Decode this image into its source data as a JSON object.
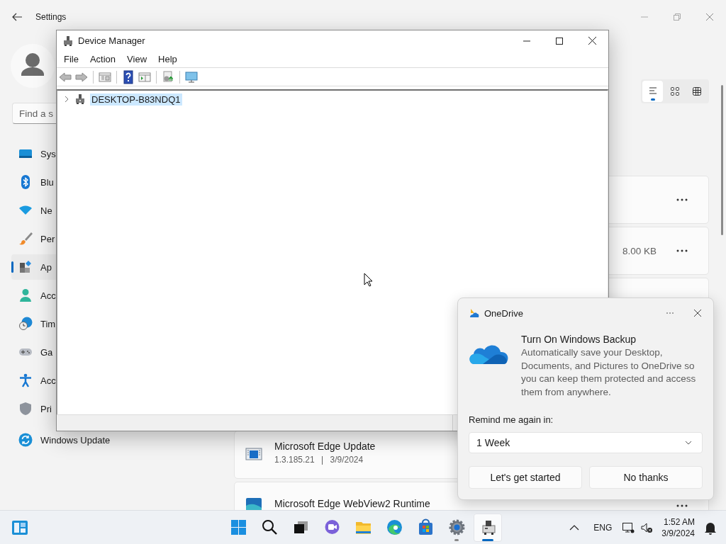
{
  "settings": {
    "title": "Settings",
    "search": {
      "placeholder": "Find a s"
    },
    "nav": [
      {
        "label": "Sys",
        "selected": false
      },
      {
        "label": "Blu",
        "selected": false
      },
      {
        "label": "Ne",
        "selected": false
      },
      {
        "label": "Per",
        "selected": false
      },
      {
        "label": "Ap",
        "selected": true
      },
      {
        "label": "Acc",
        "selected": false
      },
      {
        "label": "Tim",
        "selected": false
      },
      {
        "label": "Ga",
        "selected": false
      },
      {
        "label": "Acc",
        "selected": false
      },
      {
        "label": "Pri",
        "selected": false
      },
      {
        "label": "Windows Update",
        "selected": false
      }
    ],
    "view_modes": [
      {
        "kind": "list",
        "selected": true
      },
      {
        "kind": "grid",
        "selected": false
      },
      {
        "kind": "table",
        "selected": false
      }
    ],
    "apps": [
      {
        "menu": true
      },
      {
        "size": "8.00 KB",
        "menu": true
      },
      {
        "kind": "installer",
        "name": "Microsoft Edge Update",
        "details": "1.3.185.21 | 3/9/2024"
      },
      {
        "kind": "webview",
        "name": "Microsoft Edge WebView2 Runtime",
        "menu": true
      }
    ]
  },
  "device_manager": {
    "title": "Device Manager",
    "menu": [
      "File",
      "Action",
      "View",
      "Help"
    ],
    "tree": [
      {
        "label": "DESKTOP-B83NDQ1",
        "selected": true,
        "expanded": false
      }
    ]
  },
  "notification": {
    "app": "OneDrive",
    "title": "Turn On Windows Backup",
    "body": "Automatically save your Desktop, Documents, and Pictures to OneDrive so you can keep them protected and access them from anywhere.",
    "remind_label": "Remind me again in:",
    "remind_value": "1 Week",
    "buttons": [
      "Let's get started",
      "No thanks"
    ]
  },
  "taskbar": {
    "apps": [
      {
        "kind": "start",
        "running": false,
        "active": false
      },
      {
        "kind": "search",
        "running": false,
        "active": false
      },
      {
        "kind": "task-view",
        "running": false,
        "active": false
      },
      {
        "kind": "chat",
        "running": false,
        "active": false
      },
      {
        "kind": "explorer",
        "running": false,
        "active": false
      },
      {
        "kind": "edge",
        "running": false,
        "active": false
      },
      {
        "kind": "store",
        "running": false,
        "active": false
      },
      {
        "kind": "settings",
        "running": true,
        "active": false
      },
      {
        "kind": "device-manager",
        "running": true,
        "active": true
      }
    ],
    "language": "ENG",
    "time": "1:52 AM",
    "date": "3/9/2024"
  }
}
